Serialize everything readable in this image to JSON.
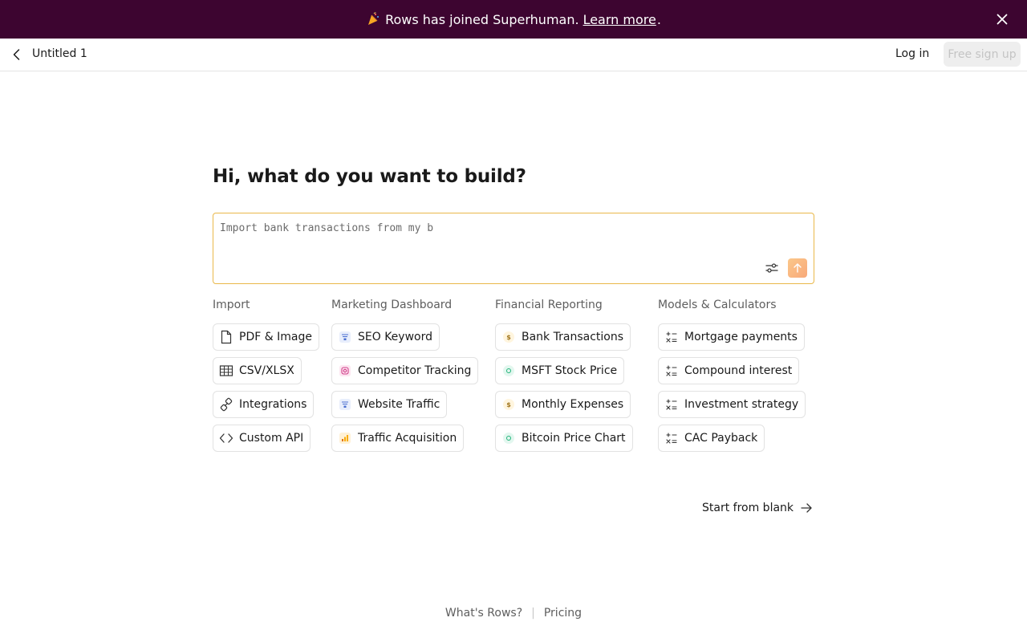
{
  "banner": {
    "message": "Rows has joined Superhuman.",
    "link": "Learn more",
    "period": "."
  },
  "topbar": {
    "doc_title": "Untitled 1",
    "login": "Log in",
    "signup": "Free sign up"
  },
  "main": {
    "heading": "Hi, what do you want to build?",
    "prompt": {
      "value": "Import bank transactions from my b",
      "placeholder": ""
    }
  },
  "categories": [
    {
      "title": "Import",
      "items": [
        {
          "label": "PDF & Image",
          "icon": "document-icon"
        },
        {
          "label": "CSV/XLSX",
          "icon": "table-icon"
        },
        {
          "label": "Integrations",
          "icon": "link-icon"
        },
        {
          "label": "Custom API",
          "icon": "code-icon"
        }
      ]
    },
    {
      "title": "Marketing Dashboard",
      "items": [
        {
          "label": "SEO Keyword",
          "icon": "search-console-icon"
        },
        {
          "label": "Competitor Tracking",
          "icon": "instagram-icon"
        },
        {
          "label": "Website Traffic",
          "icon": "search-console-icon"
        },
        {
          "label": "Traffic Acquisition",
          "icon": "analytics-icon"
        }
      ]
    },
    {
      "title": "Financial Reporting",
      "items": [
        {
          "label": "Bank Transactions",
          "icon": "dollar-icon"
        },
        {
          "label": "MSFT Stock Price",
          "icon": "coin-icon"
        },
        {
          "label": "Monthly Expenses",
          "icon": "dollar-icon"
        },
        {
          "label": "Bitcoin Price Chart",
          "icon": "coin-icon"
        }
      ]
    },
    {
      "title": "Models & Calculators",
      "items": [
        {
          "label": "Mortgage payments",
          "icon": "calculator-icon"
        },
        {
          "label": "Compound interest",
          "icon": "calculator-icon"
        },
        {
          "label": "Investment strategy",
          "icon": "calculator-icon"
        },
        {
          "label": "CAC Payback",
          "icon": "calculator-icon"
        }
      ]
    }
  ],
  "start_blank": "Start from blank",
  "footer": {
    "whats_rows": "What's Rows?",
    "separator": "|",
    "pricing": "Pricing"
  },
  "colors": {
    "banner_bg": "#3d0530",
    "prompt_border": "#e9b84a",
    "send_button": "#f8b17e"
  }
}
